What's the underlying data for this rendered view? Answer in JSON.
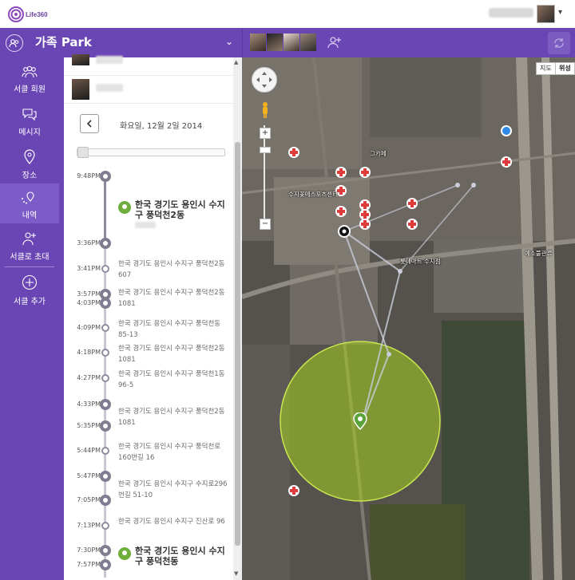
{
  "app": {
    "logo_text": "Life360"
  },
  "header": {
    "circle_name": "가족 Park"
  },
  "nav": {
    "items": [
      {
        "label": "서클 회원",
        "icon": "people-icon"
      },
      {
        "label": "메시지",
        "icon": "chat-icon"
      },
      {
        "label": "장소",
        "icon": "place-pin-icon"
      },
      {
        "label": "내역",
        "icon": "history-icon"
      },
      {
        "label": "서클로 초대",
        "icon": "add-person-icon"
      },
      {
        "label": "서클 추가",
        "icon": "plus-circle-icon"
      }
    ]
  },
  "timeline": {
    "date": "화요일, 12월 2일 2014",
    "slider_position": 0,
    "entries": [
      {
        "time": "9:48PM",
        "kind": "stay",
        "address": "한국 경기도 용인시 수지구 풍덕천2동"
      },
      {
        "time": "3:36PM",
        "kind": "stay-end"
      },
      {
        "time": "3:41PM",
        "address": "한국 경기도 용인시 수지구 풍덕천2동 607"
      },
      {
        "time": "3:57PM",
        "time2": "4:03PM",
        "address": "한국 경기도 용인시 수지구 풍덕천2동 1081"
      },
      {
        "time": "4:09PM",
        "address": "한국 경기도 용인시 수지구 풍덕천동 85-13"
      },
      {
        "time": "4:18PM",
        "address": "한국 경기도 용인시 수지구 풍덕천2동 1081"
      },
      {
        "time": "4:27PM",
        "address": "한국 경기도 용인시 수지구 풍덕천1동 96-5"
      },
      {
        "time": "4:33PM",
        "time2": "5:35PM",
        "address": "한국 경기도 용인시 수지구 풍덕천2동 1081"
      },
      {
        "time": "5:44PM",
        "address": "한국 경기도 용인시 수지구 풍덕천로160번길 16"
      },
      {
        "time": "5:47PM",
        "time2": "7:05PM",
        "address": "한국 경기도 용인시 수지구 수지로296번길 51-10"
      },
      {
        "time": "7:13PM",
        "address": "한국 경기도 용인시 수지구 진산로 96"
      },
      {
        "time": "7:30PM",
        "time2": "7:57PM",
        "kind": "stay",
        "address": "한국 경기도 용인시 수지구 풍덕천동"
      }
    ]
  },
  "map": {
    "maptype": {
      "map_label": "지도",
      "satellite_label": "위성"
    },
    "labels": [
      "수지꽃메스포츠센터",
      "그카페",
      "롯데마트 수지점",
      "예소풀관류"
    ],
    "zoom_in": "+",
    "zoom_out": "−"
  },
  "colors": {
    "brand_purple": "#6a46b5",
    "accent_green": "#8fbf2a",
    "pin_green": "#6fae3a",
    "marker_red": "#e03c3c"
  }
}
